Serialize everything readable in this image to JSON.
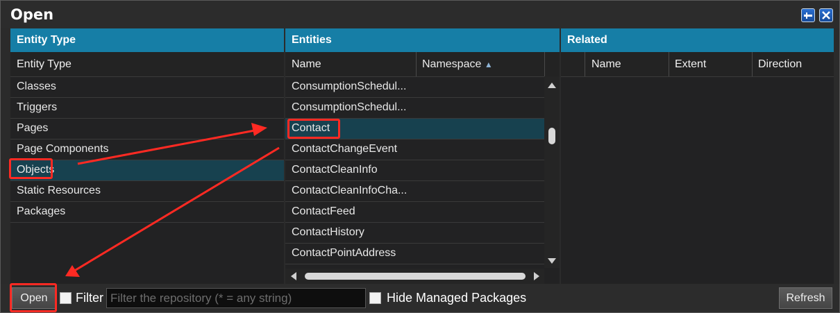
{
  "window": {
    "title": "Open"
  },
  "panes": {
    "entity_type": {
      "header": "Entity Type",
      "column": "Entity Type",
      "items": [
        "Classes",
        "Triggers",
        "Pages",
        "Page Components",
        "Objects",
        "Static Resources",
        "Packages"
      ],
      "selected": "Objects"
    },
    "entities": {
      "header": "Entities",
      "columns": {
        "name": "Name",
        "namespace": "Namespace"
      },
      "sort_indicator": "▲",
      "items": [
        "ConsumptionSchedul...",
        "ConsumptionSchedul...",
        "Contact",
        "ContactChangeEvent",
        "ContactCleanInfo",
        "ContactCleanInfoCha...",
        "ContactFeed",
        "ContactHistory",
        "ContactPointAddress"
      ],
      "selected": "Contact"
    },
    "related": {
      "header": "Related",
      "columns": {
        "name": "Name",
        "extent": "Extent",
        "direction": "Direction"
      }
    }
  },
  "footer": {
    "open_label": "Open",
    "filter_label": "Filter",
    "filter_placeholder": "Filter the repository (* = any string)",
    "hide_managed_label": "Hide Managed Packages",
    "refresh_label": "Refresh"
  },
  "annotation_color": "#ff2a23"
}
